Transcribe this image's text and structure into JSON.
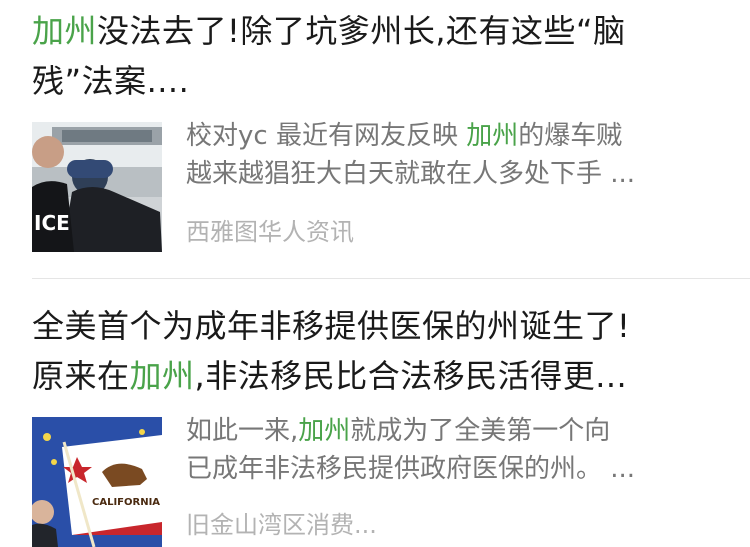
{
  "articles": [
    {
      "title_highlight": "加州",
      "title_line1_rest": "没法去了!除了坑爹州长,还有这些“脑",
      "title_line2": "残”法案....",
      "summary_line1_pre": "校对yc 最近有网友反映 ",
      "summary_line1_highlight": "加州",
      "summary_line1_post": "的爆车贼",
      "summary_line2": "越来越猖狂大白天就敢在人多处下手 ...",
      "source": "西雅图华人资讯",
      "thumbnail": {
        "icon": "police-photo",
        "badge_text": "ICE"
      }
    },
    {
      "title_line1": "全美首个为成年非移提供医保的州诞生了!",
      "title_line2_pre": "原来在",
      "title_line2_highlight": "加州",
      "title_line2_post": ",非法移民比合法移民活得更...",
      "summary_line1_pre": "如此一来,",
      "summary_line1_highlight": "加州",
      "summary_line1_post": "就成为了全美第一个向",
      "summary_line2": "已成年非法移民提供政府医保的州。 ...",
      "source": "旧金山湾区消费...",
      "thumbnail": {
        "icon": "california-flag-photo",
        "flag_text": "CALIFORNIA R"
      }
    }
  ],
  "colors": {
    "highlight": "#4aa34a",
    "title": "#1a1a1a",
    "summary": "#777777",
    "source": "#b3b3b3"
  }
}
